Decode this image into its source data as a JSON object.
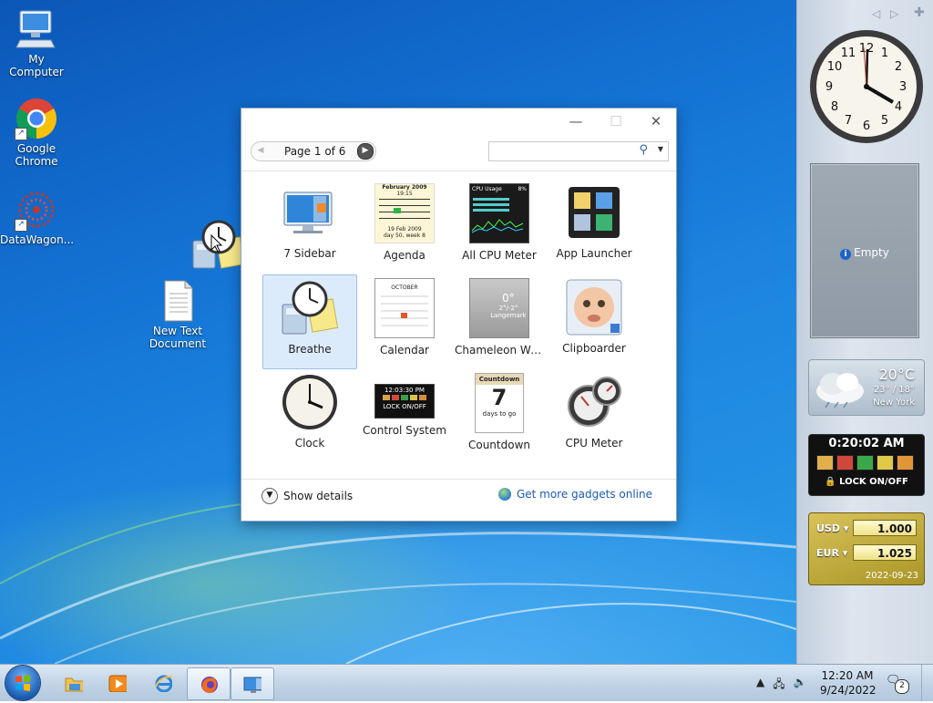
{
  "desktop": {
    "icons": [
      {
        "label": "My Computer"
      },
      {
        "label": "Google Chrome"
      },
      {
        "label": "DataWagon..."
      },
      {
        "label": "New Text Document"
      }
    ]
  },
  "gallery": {
    "pager_label": "Page 1 of 6",
    "search_placeholder": "",
    "gadgets": [
      {
        "name": "7 Sidebar"
      },
      {
        "name": "Agenda"
      },
      {
        "name": "All CPU Meter"
      },
      {
        "name": "App Launcher"
      },
      {
        "name": "Breathe",
        "selected": true
      },
      {
        "name": "Calendar"
      },
      {
        "name": "Chameleon We..."
      },
      {
        "name": "Clipboarder"
      },
      {
        "name": "Clock"
      },
      {
        "name": "Control System"
      },
      {
        "name": "Countdown"
      },
      {
        "name": "CPU Meter"
      }
    ],
    "show_details": "Show details",
    "get_more": "Get more gadgets online",
    "thumbs": {
      "agenda_month": "February 2009",
      "agenda_time": "19:15",
      "agenda_footer1": "19 Feb 2009",
      "agenda_footer2": "day 50, week 8",
      "cpu_title": "CPU Usage",
      "cpu_pct": "8%",
      "calendar_month": "OCTOBER",
      "chameleon_temp": "0°",
      "chameleon_range": "2°/-2°",
      "chameleon_city": "Langemark",
      "control_time": "12:03:30 PM",
      "control_lock": "LOCK ON/OFF",
      "countdown_title": "Countdown",
      "countdown_value": "7",
      "countdown_sub": "days to go"
    }
  },
  "sidebar": {
    "empty_label": "Empty",
    "weather": {
      "temp": "20°C",
      "range": "23° / 18°",
      "city": "New York"
    },
    "control": {
      "time": "0:20:02 AM",
      "lock": "LOCK ON/OFF"
    },
    "currency": {
      "from": "USD",
      "to": "EUR",
      "from_value": "1.000",
      "to_value": "1.025",
      "date": "2022-09-23"
    }
  },
  "taskbar": {
    "time": "12:20 AM",
    "date": "9/24/2022",
    "notifications": "2"
  }
}
